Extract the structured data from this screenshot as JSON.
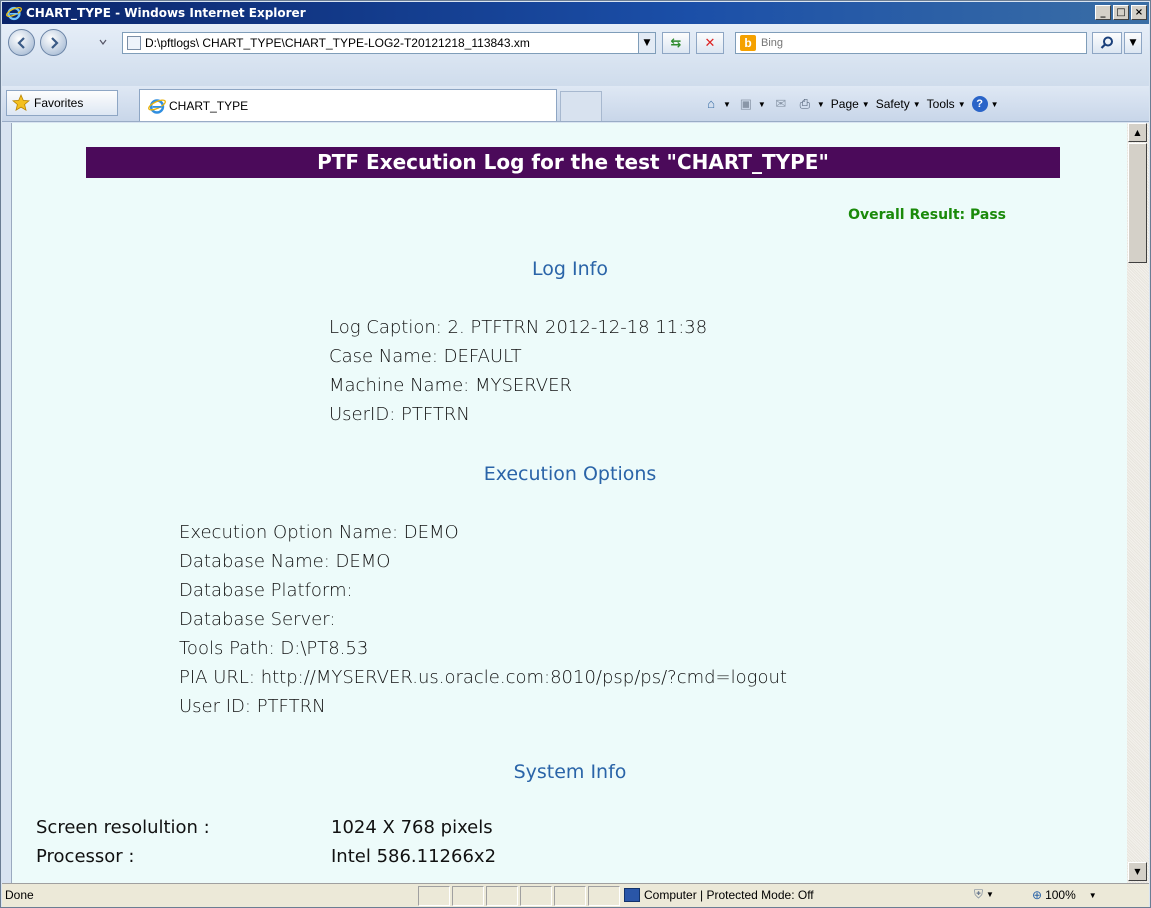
{
  "window": {
    "title": "CHART_TYPE - Windows Internet Explorer",
    "controls": {
      "minimize": "_",
      "maximize": "□",
      "close": "×"
    }
  },
  "address_bar": {
    "url": "D:\\pftlogs\\ CHART_TYPE\\CHART_TYPE-LOG2-T20121218_113843.xm",
    "refresh_icon": "refresh-icon",
    "stop_icon": "stop-icon"
  },
  "search": {
    "placeholder": "Bing",
    "engine_icon": "bing-icon"
  },
  "favorites": {
    "label": "Favorites"
  },
  "tab": {
    "label": "CHART_TYPE"
  },
  "command_bar": {
    "page": "Page",
    "safety": "Safety",
    "tools": "Tools"
  },
  "page": {
    "banner": "PTF Execution Log for the test \"CHART_TYPE\"",
    "overall_result": "Overall Result: Pass",
    "log_info": {
      "heading": "Log Info",
      "lines": [
        "Log Caption: 2. PTFTRN 2012-12-18 11:38",
        "Case Name: DEFAULT",
        "Machine Name: MYSERVER",
        "UserID: PTFTRN"
      ]
    },
    "execution_options": {
      "heading": "Execution Options",
      "lines": [
        "Execution Option Name: DEMO",
        "Database Name: DEMO",
        "Database Platform:",
        "Database Server:",
        "Tools Path: D:\\PT8.53",
        "PIA URL: http://MYSERVER.us.oracle.com:8010/psp/ps/?cmd=logout",
        "User ID: PTFTRN"
      ]
    },
    "system_info": {
      "heading": "System Info",
      "rows": [
        {
          "label": "Screen resolultion :",
          "value": "1024 X 768 pixels"
        },
        {
          "label": "Processor :",
          "value": "Intel 586.11266x2"
        }
      ]
    }
  },
  "status_bar": {
    "status": "Done",
    "zone": "Computer | Protected Mode: Off",
    "zoom": "100%"
  },
  "colors": {
    "banner_bg": "#4b0a5a",
    "section_heading": "#2a64a8",
    "pass": "#1a8a0a",
    "content_bg": "#edfbfa"
  }
}
